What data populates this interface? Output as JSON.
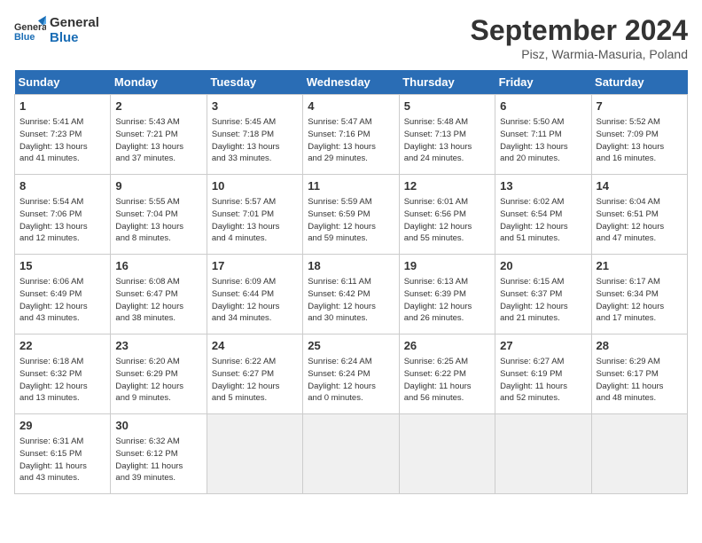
{
  "header": {
    "logo_line1": "General",
    "logo_line2": "Blue",
    "month_title": "September 2024",
    "subtitle": "Pisz, Warmia-Masuria, Poland"
  },
  "weekdays": [
    "Sunday",
    "Monday",
    "Tuesday",
    "Wednesday",
    "Thursday",
    "Friday",
    "Saturday"
  ],
  "weeks": [
    [
      {
        "day": "1",
        "detail": "Sunrise: 5:41 AM\nSunset: 7:23 PM\nDaylight: 13 hours\nand 41 minutes."
      },
      {
        "day": "2",
        "detail": "Sunrise: 5:43 AM\nSunset: 7:21 PM\nDaylight: 13 hours\nand 37 minutes."
      },
      {
        "day": "3",
        "detail": "Sunrise: 5:45 AM\nSunset: 7:18 PM\nDaylight: 13 hours\nand 33 minutes."
      },
      {
        "day": "4",
        "detail": "Sunrise: 5:47 AM\nSunset: 7:16 PM\nDaylight: 13 hours\nand 29 minutes."
      },
      {
        "day": "5",
        "detail": "Sunrise: 5:48 AM\nSunset: 7:13 PM\nDaylight: 13 hours\nand 24 minutes."
      },
      {
        "day": "6",
        "detail": "Sunrise: 5:50 AM\nSunset: 7:11 PM\nDaylight: 13 hours\nand 20 minutes."
      },
      {
        "day": "7",
        "detail": "Sunrise: 5:52 AM\nSunset: 7:09 PM\nDaylight: 13 hours\nand 16 minutes."
      }
    ],
    [
      {
        "day": "8",
        "detail": "Sunrise: 5:54 AM\nSunset: 7:06 PM\nDaylight: 13 hours\nand 12 minutes."
      },
      {
        "day": "9",
        "detail": "Sunrise: 5:55 AM\nSunset: 7:04 PM\nDaylight: 13 hours\nand 8 minutes."
      },
      {
        "day": "10",
        "detail": "Sunrise: 5:57 AM\nSunset: 7:01 PM\nDaylight: 13 hours\nand 4 minutes."
      },
      {
        "day": "11",
        "detail": "Sunrise: 5:59 AM\nSunset: 6:59 PM\nDaylight: 12 hours\nand 59 minutes."
      },
      {
        "day": "12",
        "detail": "Sunrise: 6:01 AM\nSunset: 6:56 PM\nDaylight: 12 hours\nand 55 minutes."
      },
      {
        "day": "13",
        "detail": "Sunrise: 6:02 AM\nSunset: 6:54 PM\nDaylight: 12 hours\nand 51 minutes."
      },
      {
        "day": "14",
        "detail": "Sunrise: 6:04 AM\nSunset: 6:51 PM\nDaylight: 12 hours\nand 47 minutes."
      }
    ],
    [
      {
        "day": "15",
        "detail": "Sunrise: 6:06 AM\nSunset: 6:49 PM\nDaylight: 12 hours\nand 43 minutes."
      },
      {
        "day": "16",
        "detail": "Sunrise: 6:08 AM\nSunset: 6:47 PM\nDaylight: 12 hours\nand 38 minutes."
      },
      {
        "day": "17",
        "detail": "Sunrise: 6:09 AM\nSunset: 6:44 PM\nDaylight: 12 hours\nand 34 minutes."
      },
      {
        "day": "18",
        "detail": "Sunrise: 6:11 AM\nSunset: 6:42 PM\nDaylight: 12 hours\nand 30 minutes."
      },
      {
        "day": "19",
        "detail": "Sunrise: 6:13 AM\nSunset: 6:39 PM\nDaylight: 12 hours\nand 26 minutes."
      },
      {
        "day": "20",
        "detail": "Sunrise: 6:15 AM\nSunset: 6:37 PM\nDaylight: 12 hours\nand 21 minutes."
      },
      {
        "day": "21",
        "detail": "Sunrise: 6:17 AM\nSunset: 6:34 PM\nDaylight: 12 hours\nand 17 minutes."
      }
    ],
    [
      {
        "day": "22",
        "detail": "Sunrise: 6:18 AM\nSunset: 6:32 PM\nDaylight: 12 hours\nand 13 minutes."
      },
      {
        "day": "23",
        "detail": "Sunrise: 6:20 AM\nSunset: 6:29 PM\nDaylight: 12 hours\nand 9 minutes."
      },
      {
        "day": "24",
        "detail": "Sunrise: 6:22 AM\nSunset: 6:27 PM\nDaylight: 12 hours\nand 5 minutes."
      },
      {
        "day": "25",
        "detail": "Sunrise: 6:24 AM\nSunset: 6:24 PM\nDaylight: 12 hours\nand 0 minutes."
      },
      {
        "day": "26",
        "detail": "Sunrise: 6:25 AM\nSunset: 6:22 PM\nDaylight: 11 hours\nand 56 minutes."
      },
      {
        "day": "27",
        "detail": "Sunrise: 6:27 AM\nSunset: 6:19 PM\nDaylight: 11 hours\nand 52 minutes."
      },
      {
        "day": "28",
        "detail": "Sunrise: 6:29 AM\nSunset: 6:17 PM\nDaylight: 11 hours\nand 48 minutes."
      }
    ],
    [
      {
        "day": "29",
        "detail": "Sunrise: 6:31 AM\nSunset: 6:15 PM\nDaylight: 11 hours\nand 43 minutes."
      },
      {
        "day": "30",
        "detail": "Sunrise: 6:32 AM\nSunset: 6:12 PM\nDaylight: 11 hours\nand 39 minutes."
      },
      {
        "day": "",
        "detail": "",
        "empty": true
      },
      {
        "day": "",
        "detail": "",
        "empty": true
      },
      {
        "day": "",
        "detail": "",
        "empty": true
      },
      {
        "day": "",
        "detail": "",
        "empty": true
      },
      {
        "day": "",
        "detail": "",
        "empty": true
      }
    ]
  ]
}
